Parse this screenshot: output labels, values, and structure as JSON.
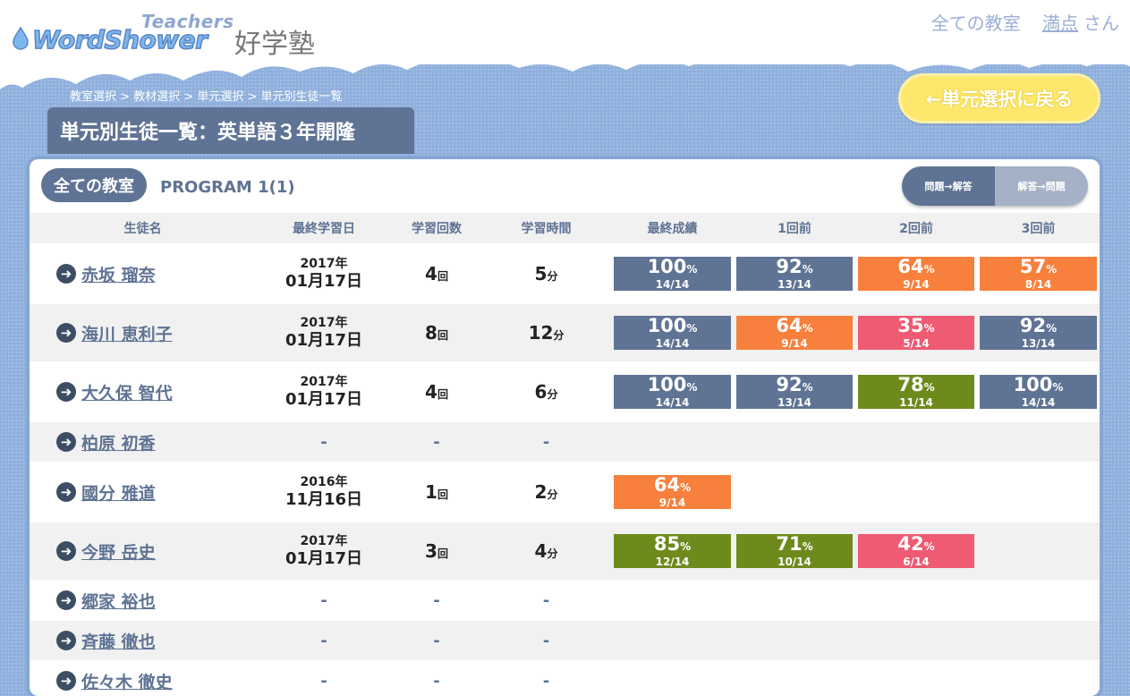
{
  "header": {
    "logo_teachers": "Teachers",
    "logo_word": "WordShower",
    "logo_juku": "好学塾",
    "all_classes_link": "全ての教室",
    "user_name": "満点",
    "user_suffix": "さん"
  },
  "breadcrumb": "教室選択 > 教材選択 > 単元選択 > 単元別生徒一覧",
  "back_button": "←単元選択に戻る",
  "page_title": "単元別生徒一覧：英単語３年開隆",
  "panel": {
    "class_pill": "全ての教室",
    "program": "PROGRAM 1(1)",
    "toggle_q2a": "問題→解答",
    "toggle_a2q": "解答→問題"
  },
  "columns": [
    "生徒名",
    "最終学習日",
    "学習回数",
    "学習時間",
    "最終成績",
    "1回前",
    "2回前",
    "3回前"
  ],
  "students": [
    {
      "name": "赤坂 瑠奈",
      "year": "2017年",
      "md": "01月17日",
      "count": "4",
      "count_unit": "回",
      "time": "5",
      "time_unit": "分",
      "scores": [
        {
          "pct": "100",
          "frac": "14/14",
          "color": "blue"
        },
        {
          "pct": "92",
          "frac": "13/14",
          "color": "blue"
        },
        {
          "pct": "64",
          "frac": "9/14",
          "color": "orange"
        },
        {
          "pct": "57",
          "frac": "8/14",
          "color": "orange"
        }
      ]
    },
    {
      "name": "海川 恵利子",
      "year": "2017年",
      "md": "01月17日",
      "count": "8",
      "count_unit": "回",
      "time": "12",
      "time_unit": "分",
      "scores": [
        {
          "pct": "100",
          "frac": "14/14",
          "color": "blue"
        },
        {
          "pct": "64",
          "frac": "9/14",
          "color": "orange"
        },
        {
          "pct": "35",
          "frac": "5/14",
          "color": "pink"
        },
        {
          "pct": "92",
          "frac": "13/14",
          "color": "blue"
        }
      ]
    },
    {
      "name": "大久保 智代",
      "year": "2017年",
      "md": "01月17日",
      "count": "4",
      "count_unit": "回",
      "time": "6",
      "time_unit": "分",
      "scores": [
        {
          "pct": "100",
          "frac": "14/14",
          "color": "blue"
        },
        {
          "pct": "92",
          "frac": "13/14",
          "color": "blue"
        },
        {
          "pct": "78",
          "frac": "11/14",
          "color": "green"
        },
        {
          "pct": "100",
          "frac": "14/14",
          "color": "blue"
        }
      ]
    },
    {
      "name": "柏原 初香",
      "dash": "-",
      "scores": []
    },
    {
      "name": "國分 雅道",
      "year": "2016年",
      "md": "11月16日",
      "count": "1",
      "count_unit": "回",
      "time": "2",
      "time_unit": "分",
      "scores": [
        {
          "pct": "64",
          "frac": "9/14",
          "color": "orange"
        }
      ]
    },
    {
      "name": "今野 岳史",
      "year": "2017年",
      "md": "01月17日",
      "count": "3",
      "count_unit": "回",
      "time": "4",
      "time_unit": "分",
      "scores": [
        {
          "pct": "85",
          "frac": "12/14",
          "color": "green"
        },
        {
          "pct": "71",
          "frac": "10/14",
          "color": "green"
        },
        {
          "pct": "42",
          "frac": "6/14",
          "color": "pink"
        }
      ]
    },
    {
      "name": "郷家 裕也",
      "dash": "-",
      "scores": []
    },
    {
      "name": "斉藤 徹也",
      "dash": "-",
      "scores": []
    },
    {
      "name": "佐々木 徹史",
      "dash": "-",
      "scores": []
    }
  ],
  "pct_symbol": "%",
  "colors": {
    "blue": "#5f7394",
    "orange": "#f7803d",
    "pink": "#ee5b73",
    "green": "#6d8b1d",
    "back_button": "#fde76d"
  }
}
